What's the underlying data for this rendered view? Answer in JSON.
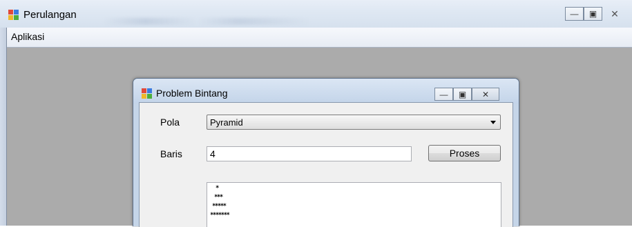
{
  "outer_window": {
    "title": "Perulangan",
    "controls": {
      "minimize_icon": "minimize-icon",
      "maximize_icon": "maximize-icon",
      "close_icon": "close-icon"
    }
  },
  "menubar": {
    "items": [
      {
        "label": "Aplikasi"
      }
    ]
  },
  "child_window": {
    "title": "Problem Bintang",
    "form": {
      "pola_label": "Pola",
      "pola_value": "Pyramid",
      "baris_label": "Baris",
      "baris_value": "4",
      "proses_label": "Proses"
    },
    "output_lines": [
      "*",
      "***",
      "*****",
      "*******"
    ]
  },
  "colors": {
    "mdi_background": "#ababab",
    "title_bar": "#dbe6f4",
    "client": "#f0f0f0"
  }
}
